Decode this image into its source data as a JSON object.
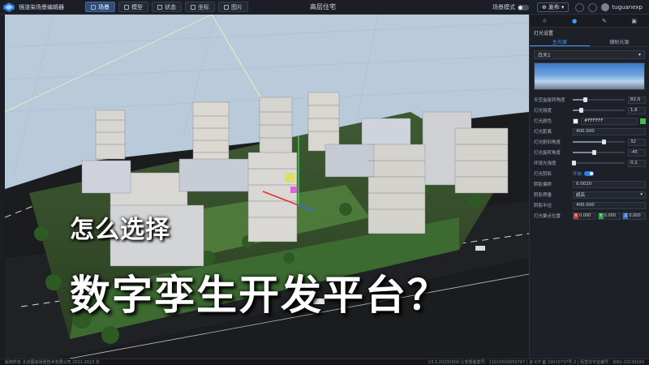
{
  "app": {
    "title": "镜渲染场景编辑器",
    "scene_title": "高层住宅"
  },
  "menu": {
    "tabs": [
      {
        "label": "场景",
        "icon": "scene-icon",
        "active": true
      },
      {
        "label": "模型",
        "icon": "model-icon",
        "active": false
      },
      {
        "label": "状态",
        "icon": "state-icon",
        "active": false
      },
      {
        "label": "坐标",
        "icon": "coordinate-icon",
        "active": false
      },
      {
        "label": "图片",
        "icon": "image-icon",
        "active": false
      }
    ]
  },
  "header_right": {
    "scene_mode_label": "场景模式",
    "publish_label": "发布",
    "username": "tuguanexp"
  },
  "overlay": {
    "line1": "怎么选择",
    "line2": "数字孪生开发平台？"
  },
  "panel": {
    "tab_icons": [
      "sun-icon",
      "light-icon",
      "brush-icon",
      "image-icon"
    ],
    "section_title": "灯光设置",
    "sub_tabs": [
      "主光源",
      "辅助光源"
    ],
    "preset": "白天1",
    "rows": [
      {
        "label": "天空盒旋转角度",
        "type": "slider",
        "value": "82.0",
        "fill": 0.23
      },
      {
        "label": "灯光强度",
        "type": "slider",
        "value": "1.6",
        "fill": 0.16
      },
      {
        "label": "灯光颜色",
        "type": "color",
        "value": "#FFFFFF"
      },
      {
        "label": "灯光距离",
        "type": "field",
        "value": "400.000"
      },
      {
        "label": "灯光俯仰角度",
        "type": "slider",
        "value": "32",
        "fill": 0.6
      },
      {
        "label": "灯光旋转角度",
        "type": "slider",
        "value": "-45",
        "fill": 0.4
      },
      {
        "label": "环境光强度",
        "type": "slider",
        "value": "0.2",
        "fill": 0.02
      },
      {
        "label": "灯光阴影",
        "type": "toggle",
        "value": "开启"
      },
      {
        "label": "阴影偏移",
        "type": "field",
        "value": "0.0020"
      },
      {
        "label": "阴影质量",
        "type": "select",
        "value": "超高"
      },
      {
        "label": "阴影半径",
        "type": "field",
        "value": "400.000"
      },
      {
        "label": "灯光聚点位置",
        "type": "vector",
        "x": "0.000",
        "y": "0.000",
        "z": "0.000"
      }
    ]
  },
  "status": {
    "left": "版权所有 北京图来场景技术有限公司 2021-2023 年",
    "right": "V3.3.20230309 公安部备案号：11010502050767 | 京 ICP 备 19010737号-2 | 经营许可证编号：京B2-20230029"
  },
  "colors": {
    "accent": "#3fa0ff",
    "active_tab": "#2f4d78",
    "panel_bg": "#1d2026"
  }
}
